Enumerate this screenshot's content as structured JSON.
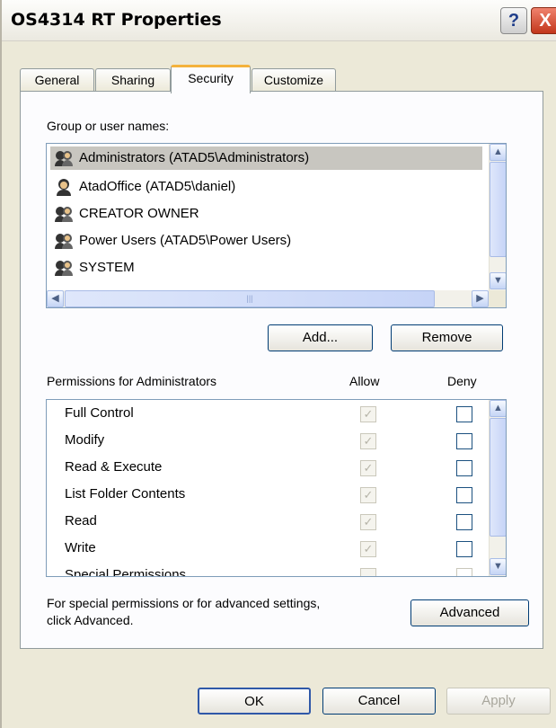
{
  "window": {
    "title": "OS4314 RT Properties",
    "help_label": "?",
    "close_label": "X"
  },
  "tabs": [
    {
      "label": "General"
    },
    {
      "label": "Sharing"
    },
    {
      "label": "Security"
    },
    {
      "label": "Customize"
    }
  ],
  "security": {
    "group_label": "Group or user names:",
    "users": [
      {
        "name": "Administrators (ATAD5\\Administrators)",
        "icon": "user-group-icon",
        "selected": true
      },
      {
        "name": "AtadOffice (ATAD5\\daniel)",
        "icon": "user-icon"
      },
      {
        "name": "CREATOR OWNER",
        "icon": "user-group-icon"
      },
      {
        "name": "Power Users (ATAD5\\Power Users)",
        "icon": "user-group-icon"
      },
      {
        "name": "SYSTEM",
        "icon": "user-group-icon"
      }
    ],
    "add_label": "Add...",
    "remove_label": "Remove",
    "permissions_label": "Permissions for Administrators",
    "allow_label": "Allow",
    "deny_label": "Deny",
    "permissions": [
      {
        "name": "Full Control",
        "allow": true,
        "deny": false
      },
      {
        "name": "Modify",
        "allow": true,
        "deny": false
      },
      {
        "name": "Read & Execute",
        "allow": true,
        "deny": false
      },
      {
        "name": "List Folder Contents",
        "allow": true,
        "deny": false
      },
      {
        "name": "Read",
        "allow": true,
        "deny": false
      },
      {
        "name": "Write",
        "allow": true,
        "deny": false
      },
      {
        "name": "Special Permissions",
        "allow": false,
        "deny": false
      }
    ],
    "advanced_text_1": "For special permissions or for advanced settings,",
    "advanced_text_2": "click Advanced.",
    "advanced_label": "Advanced",
    "scroll_up_glyph": "▲",
    "scroll_down_glyph": "▼",
    "scroll_left_glyph": "◀",
    "scroll_right_glyph": "▶",
    "thumb_grip": "|||"
  },
  "footer": {
    "ok_label": "OK",
    "cancel_label": "Cancel",
    "apply_label": "Apply"
  }
}
